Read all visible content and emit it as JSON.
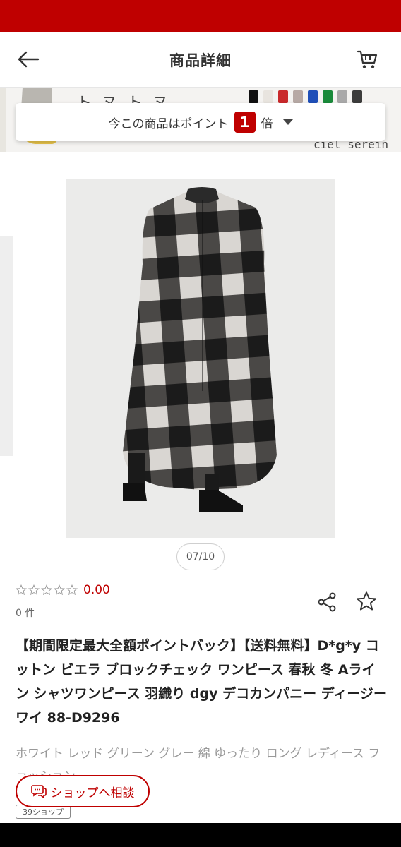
{
  "header": {
    "title": "商品詳細",
    "back_icon": "arrow-left-icon",
    "cart_icon": "cart-icon"
  },
  "banner": {
    "shop_name": "ciel serein",
    "characters": "トヌトヌ",
    "swatch_colors": [
      "#111111",
      "#e8e4df",
      "#c9292b",
      "#b7a9a5",
      "#1f4fb8",
      "#1a8a3b",
      "#a9a9a9",
      "#3c3c3c"
    ]
  },
  "point": {
    "prefix": "今この商品はポイント",
    "multiplier": "1",
    "suffix": "倍"
  },
  "carousel": {
    "counter": "07/10"
  },
  "rating": {
    "stars": 0,
    "score": "0.00",
    "count": "0 件"
  },
  "product": {
    "title": "【期間限定最大全額ポイントバック】【送料無料】D*g*y コットン ビエラ ブロックチェック ワンピース 春秋 冬 Aライン シャツワンピース 羽織り dgy デコカンパニー ディージーワイ 88-D9296",
    "subtitle": "ホワイト レッド グリーン グレー 綿 ゆったり ロング レディース ファッション"
  },
  "actions": {
    "consult_label": "ショップへ相談",
    "tag_label": "39ショップ"
  },
  "colors": {
    "brand_red": "#bf0000"
  }
}
